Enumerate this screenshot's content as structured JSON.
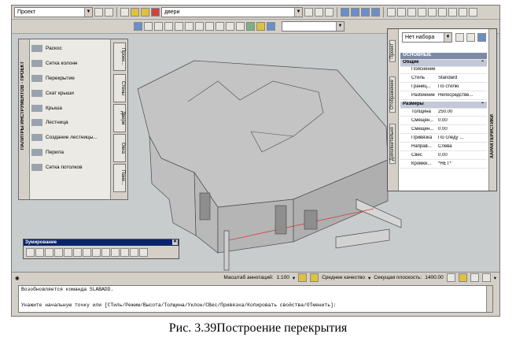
{
  "toolbar1": {
    "project_select": "Проект",
    "layer_select": "двери"
  },
  "palette": {
    "vertical_title": "ПАЛИТРЫ ИНСТРУМЕНТОВ - ПРОЕКТ",
    "items": [
      {
        "label": "Раскос"
      },
      {
        "label": "Сетка колонн"
      },
      {
        "label": "Перекрытие"
      },
      {
        "label": "Скат крыши"
      },
      {
        "label": "Крыша"
      },
      {
        "label": "Лестница"
      },
      {
        "label": "Создание лестницы..."
      },
      {
        "label": "Перила"
      },
      {
        "label": "Сетка потолков"
      }
    ],
    "tabs": [
      "Проек...",
      "Стены",
      "Двери",
      "Окна",
      "Пане..."
    ]
  },
  "properties": {
    "vertical_title": "ХАРАКТЕРИСТИКИ",
    "selection": "Нет набора",
    "left_tabs": [
      "Проект",
      "Отображение",
      "Дополнительно"
    ],
    "section_main": "ОСНОВНЫЕ",
    "cat_general": "Общие",
    "cat_sizes": "Размеры",
    "rows": [
      {
        "label": "Пояснение",
        "value": ""
      },
      {
        "label": "Стиль",
        "value": "Standard"
      },
      {
        "label": "Границ...",
        "value": "По стилю"
      },
      {
        "label": "Разбиение",
        "value": "Непосредстве..."
      },
      {
        "label": "Толщина",
        "value": "250.00"
      },
      {
        "label": "Смещен...",
        "value": "0.00"
      },
      {
        "label": "Смещен...",
        "value": "0.00"
      },
      {
        "label": "Привязка",
        "value": "По следу ..."
      },
      {
        "label": "Направ...",
        "value": "Слева"
      },
      {
        "label": "Свес",
        "value": "0.00"
      },
      {
        "label": "Кромки...",
        "value": "*НЕТ*"
      }
    ]
  },
  "zoom_toolbar": {
    "title": "Зумирование",
    "close": "✕"
  },
  "status_bar": {
    "annotation_scale_label": "Масштаб аннотаций:",
    "annotation_scale": "1:100",
    "quality": "Среднее качество",
    "section_label": "Секущая плоскость:",
    "section_value": "1400.00"
  },
  "command_line": {
    "line1": "Возобновляется команда SLABADD.",
    "line2": "",
    "line3": "Укажите начальную точку или [СТиль/Режим/Высота/Толщина/Уклон/СВес/Привязка/Копировать свойства/ОТменить]:"
  },
  "caption": "Рис. 3.39Построение перекрытия",
  "colors": {
    "viewport": "#c9cccd",
    "title_bar": "#0a246a",
    "props_header": "#7d8aa6"
  }
}
